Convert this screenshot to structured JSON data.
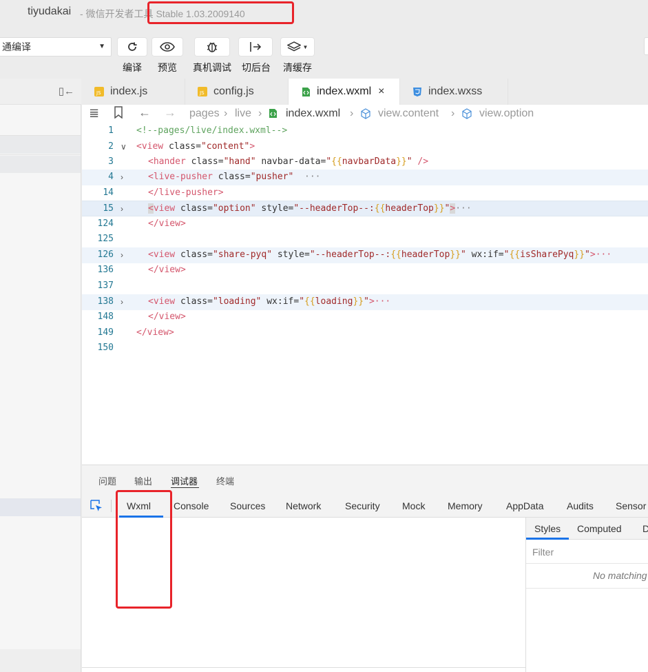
{
  "window": {
    "app_name": "tiyudakai",
    "subtitle": "- 微信开发者工具 Stable 1.03.2009140"
  },
  "toolbar": {
    "compile_mode": "通编译",
    "buttons": [
      {
        "label": "编译",
        "icon": "refresh-icon"
      },
      {
        "label": "预览",
        "icon": "eye-icon"
      },
      {
        "label": "真机调试",
        "icon": "bug-icon"
      },
      {
        "label": "切后台",
        "icon": "switch-background-icon"
      },
      {
        "label": "清缓存",
        "icon": "layers-icon"
      }
    ]
  },
  "tabs": [
    {
      "label": "index.js",
      "icon": "js-file-icon",
      "active": false
    },
    {
      "label": "config.js",
      "icon": "js-file-icon",
      "active": false
    },
    {
      "label": "index.wxml",
      "icon": "wxml-file-icon",
      "active": true,
      "close": "×"
    },
    {
      "label": "index.wxss",
      "icon": "css-file-icon",
      "active": false
    }
  ],
  "breadcrumb": {
    "items": [
      "pages",
      "live",
      "index.wxml",
      "view.content",
      "view.option"
    ]
  },
  "code": {
    "line_numbers": [
      "1",
      "2",
      "3",
      "4",
      "14",
      "15",
      "124",
      "125",
      "126",
      "136",
      "137",
      "138",
      "148",
      "149",
      "150"
    ],
    "lines": {
      "l1_comment": "<!--pages/live/index.wxml-->",
      "l2_tag": "<view",
      "l2_attr": " class=",
      "l2_val": "\"content\"",
      "l2_end": ">",
      "l3_tag": "<hander",
      "l3_attr1": " class=",
      "l3_val1": "\"hand\"",
      "l3_attr2": " navbar-data=",
      "l3_q1": "\"",
      "l3_m1": "{{",
      "l3_var": "navbarData",
      "l3_m2": "}}",
      "l3_q2": "\"",
      "l3_end": " />",
      "l4_tag": "<live-pusher",
      "l4_attr": " class=",
      "l4_val": "\"pusher\"",
      "l4_more": "  ···",
      "l14_close": "</live-pusher>",
      "l15_lt": "<",
      "l15_tag": "view",
      "l15_attr1": " class=",
      "l15_val1": "\"option\"",
      "l15_attr2": " style=",
      "l15_val2": "\"--headerTop--:",
      "l15_m1": "{{",
      "l15_var": "headerTop",
      "l15_m2": "}}",
      "l15_q": "\"",
      "l15_end": ">",
      "l15_more": "···",
      "l124_close": "</view>",
      "l126_tag": "<view",
      "l126_attr1": " class=",
      "l126_val1": "\"share-pyq\"",
      "l126_attr2": " style=",
      "l126_val2": "\"--headerTop--:",
      "l126_m1": "{{",
      "l126_var": "headerTop",
      "l126_m2": "}}",
      "l126_q": "\"",
      "l126_attr3": " wx:if=",
      "l126_q3": "\"",
      "l126_m3": "{{",
      "l126_var2": "isSharePyq",
      "l126_m4": "}}",
      "l126_q4": "\"",
      "l126_end": ">···",
      "l136_close": "</view>",
      "l138_tag": "<view",
      "l138_attr1": " class=",
      "l138_val1": "\"loading\"",
      "l138_attr2": " wx:if=",
      "l138_q1": "\"",
      "l138_m1": "{{",
      "l138_var": "loading",
      "l138_m2": "}}",
      "l138_q2": "\"",
      "l138_end": ">···",
      "l148_close": "</view>",
      "l149_close": "</view>"
    }
  },
  "panel_tabs": [
    "问题",
    "输出",
    "调试器",
    "终端"
  ],
  "devtools_tabs": [
    "Wxml",
    "Console",
    "Sources",
    "Network",
    "Security",
    "Mock",
    "Memory",
    "AppData",
    "Audits",
    "Sensor"
  ],
  "styles_pane": {
    "tabs": [
      "Styles",
      "Computed",
      "D"
    ],
    "filter_placeholder": "Filter",
    "empty_message": "No matching"
  },
  "colors": {
    "accent": "#1a73e8",
    "highlight": "#e8232a"
  }
}
